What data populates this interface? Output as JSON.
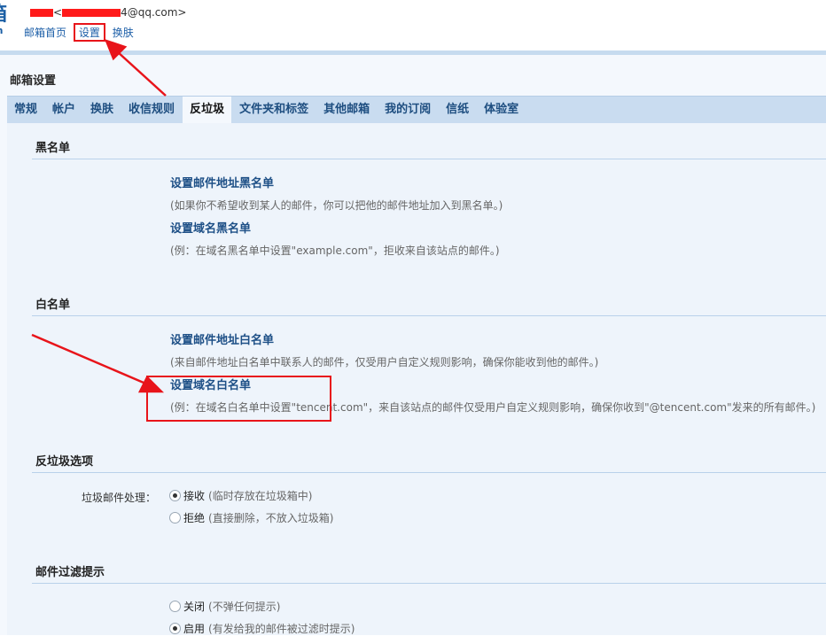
{
  "header": {
    "logo_glyph_top": "箱",
    "logo_glyph_bottom": "m",
    "account_mid": "@qq.com>",
    "account_pre": "<",
    "account_tail": "4",
    "nav": {
      "home": "邮箱首页",
      "settings": "设置",
      "skin": "换肤"
    }
  },
  "page_title": "邮箱设置",
  "tabs": [
    "常规",
    "帐户",
    "换肤",
    "收信规则",
    "反垃圾",
    "文件夹和标签",
    "其他邮箱",
    "我的订阅",
    "信纸",
    "体验室"
  ],
  "active_tab": "反垃圾",
  "blacklist": {
    "title": "黑名单",
    "address_link": "设置邮件地址黑名单",
    "address_desc": "(如果你不希望收到某人的邮件，你可以把他的邮件地址加入到黑名单。)",
    "domain_link": "设置域名黑名单",
    "domain_desc": "(例：在域名黑名单中设置\"example.com\"，拒收来自该站点的邮件。)"
  },
  "whitelist": {
    "title": "白名单",
    "address_link": "设置邮件地址白名单",
    "address_desc": "(来自邮件地址白名单中联系人的邮件，仅受用户自定义规则影响，确保你能收到他的邮件。)",
    "domain_link": "设置域名白名单",
    "domain_desc": "(例：在域名白名单中设置\"tencent.com\"，来自该站点的邮件仅受用户自定义规则影响，确保你收到\"@tencent.com\"发来的所有邮件。)"
  },
  "spam_options": {
    "title": "反垃圾选项",
    "label": "垃圾邮件处理：",
    "options": [
      {
        "text": "接收",
        "note": "(临时存放在垃圾箱中)",
        "selected": true
      },
      {
        "text": "拒绝",
        "note": "(直接删除，不放入垃圾箱)",
        "selected": false
      }
    ]
  },
  "filter_notice": {
    "title": "邮件过滤提示",
    "options": [
      {
        "text": "关闭",
        "note": "(不弹任何提示)",
        "selected": false
      },
      {
        "text": "启用",
        "note": "(有发给我的邮件被过滤时提示)",
        "selected": true
      }
    ]
  },
  "colors": {
    "link": "#1d4f86",
    "tab_bar": "#c9dcf0",
    "annotation_red": "#e8141a",
    "redaction": "#ff1a1a"
  }
}
